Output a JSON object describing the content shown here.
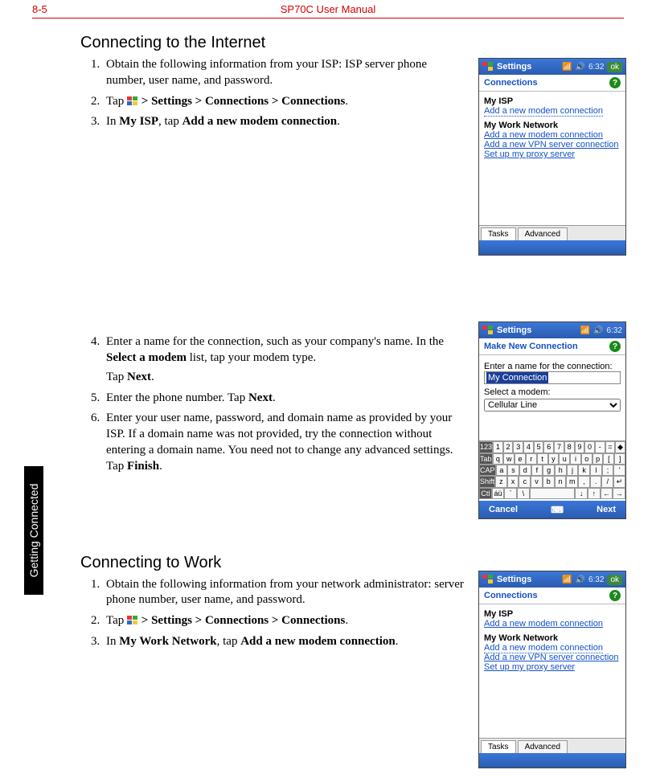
{
  "header": {
    "page": "8-5",
    "title": "SP70C User Manual"
  },
  "sidebar": {
    "label": "Getting Connected"
  },
  "section_internet": {
    "title": "Connecting to the Internet",
    "steps": {
      "s1": "Obtain the following information from your ISP: ISP server phone number, user name, and password.",
      "s2a": "Tap ",
      "s2b": " > Settings > Connections > Connections",
      "s2c": ".",
      "s3a": "In ",
      "s3b": "My ISP",
      "s3c": ", tap ",
      "s3d": "Add a new modem connection",
      "s3e": ".",
      "s4a": "Enter a name for the connection, such as your company's name. In the ",
      "s4b": "Select a modem",
      "s4c": " list, tap your modem type.",
      "s4_tap": "Tap ",
      "s4_next": "Next",
      "s4_dot": ".",
      "s5a": "Enter the phone number. Tap ",
      "s5b": "Next",
      "s5c": ".",
      "s6a": "Enter your user name, password, and domain name as provided by your ISP. If a domain name was not provided, try the connection without entering a domain name. You need not to change any advanced settings. Tap ",
      "s6b": "Finish",
      "s6c": "."
    }
  },
  "section_work": {
    "title": "Connecting to Work",
    "steps": {
      "s1": "Obtain the following information from your network administrator: server phone number, user name, and password.",
      "s2a": "Tap ",
      "s2b": " > Settings > Connections > Connections",
      "s2c": ".",
      "s3a": "In ",
      "s3b": "My Work Network",
      "s3c": ", tap ",
      "s3d": "Add a new modem connection",
      "s3e": "."
    }
  },
  "shot_conn": {
    "titlebar": "Settings",
    "time": "6:32",
    "ok": "ok",
    "header": "Connections",
    "group1": "My ISP",
    "link1": "Add a new modem connection",
    "group2": "My Work Network",
    "link2a": "Add a new modem connection",
    "link2b": "Add a new VPN server connection",
    "link2c": "Set up my proxy server",
    "tab1": "Tasks",
    "tab2": "Advanced"
  },
  "shot_newconn": {
    "titlebar": "Settings",
    "time": "6:32",
    "header": "Make New Connection",
    "lbl_name": "Enter a name for the connection:",
    "val_name": "My Connection",
    "lbl_modem": "Select a modem:",
    "val_modem": "Cellular Line",
    "sk_left": "Cancel",
    "sk_right": "Next",
    "kb": {
      "r0": [
        "123",
        "1",
        "2",
        "3",
        "4",
        "5",
        "6",
        "7",
        "8",
        "9",
        "0",
        "-",
        "=",
        "◆"
      ],
      "r1": [
        "Tab",
        "q",
        "w",
        "e",
        "r",
        "t",
        "y",
        "u",
        "i",
        "o",
        "p",
        "[",
        "]"
      ],
      "r2": [
        "CAP",
        "a",
        "s",
        "d",
        "f",
        "g",
        "h",
        "j",
        "k",
        "l",
        ";",
        "'"
      ],
      "r3": [
        "Shift",
        "z",
        "x",
        "c",
        "v",
        "b",
        "n",
        "m",
        ",",
        ".",
        "/",
        "↵"
      ],
      "r4": [
        "Ctl",
        "áü",
        "`",
        "\\",
        " ",
        "↓",
        "↑",
        "←",
        "→"
      ]
    }
  }
}
